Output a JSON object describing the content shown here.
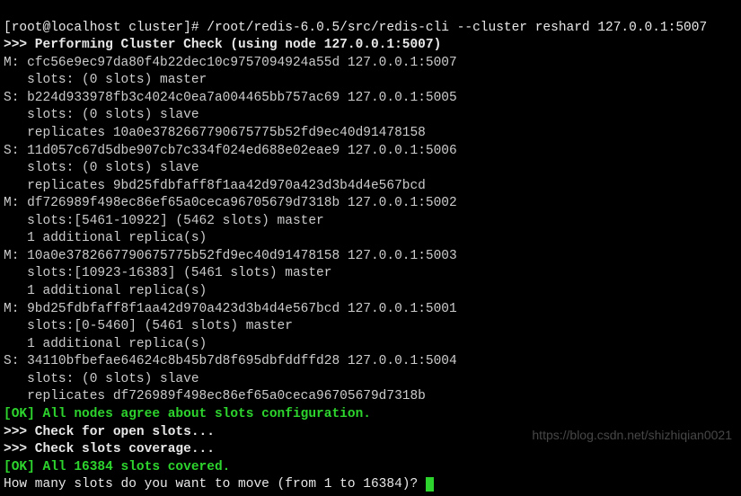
{
  "prompt": {
    "user_host": "[root@localhost cluster]# ",
    "cmd": "/root/redis-6.0.5/src/redis-cli --cluster reshard 127.0.0.1:5007"
  },
  "header": ">>> Performing Cluster Check (using node 127.0.0.1:5007)",
  "nodes": [
    {
      "role": "M:",
      "id": "cfc56e9ec97da80f4b22dec10c9757094924a55d",
      "addr": "127.0.0.1:5007",
      "l2": "   slots: (0 slots) master"
    },
    {
      "role": "S:",
      "id": "b224d933978fb3c4024c0ea7a004465bb757ac69",
      "addr": "127.0.0.1:5005",
      "l2": "   slots: (0 slots) slave",
      "l3": "   replicates 10a0e3782667790675775b52fd9ec40d91478158"
    },
    {
      "role": "S:",
      "id": "11d057c67d5dbe907cb7c334f024ed688e02eae9",
      "addr": "127.0.0.1:5006",
      "l2": "   slots: (0 slots) slave",
      "l3": "   replicates 9bd25fdbfaff8f1aa42d970a423d3b4d4e567bcd"
    },
    {
      "role": "M:",
      "id": "df726989f498ec86ef65a0ceca96705679d7318b",
      "addr": "127.0.0.1:5002",
      "l2": "   slots:[5461-10922] (5462 slots) master",
      "l3": "   1 additional replica(s)"
    },
    {
      "role": "M:",
      "id": "10a0e3782667790675775b52fd9ec40d91478158",
      "addr": "127.0.0.1:5003",
      "l2": "   slots:[10923-16383] (5461 slots) master",
      "l3": "   1 additional replica(s)"
    },
    {
      "role": "M:",
      "id": "9bd25fdbfaff8f1aa42d970a423d3b4d4e567bcd",
      "addr": "127.0.0.1:5001",
      "l2": "   slots:[0-5460] (5461 slots) master",
      "l3": "   1 additional replica(s)"
    },
    {
      "role": "S:",
      "id": "34110bfbefae64624c8b45b7d8f695dbfddffd28",
      "addr": "127.0.0.1:5004",
      "l2": "   slots: (0 slots) slave",
      "l3": "   replicates df726989f498ec86ef65a0ceca96705679d7318b"
    }
  ],
  "ok1": "[OK] All nodes agree about slots configuration.",
  "check_open": ">>> Check for open slots...",
  "check_cov": ">>> Check slots coverage...",
  "ok2": "[OK] All 16384 slots covered.",
  "question": "How many slots do you want to move (from 1 to 16384)? ",
  "watermark": "https://blog.csdn.net/shizhiqian0021"
}
